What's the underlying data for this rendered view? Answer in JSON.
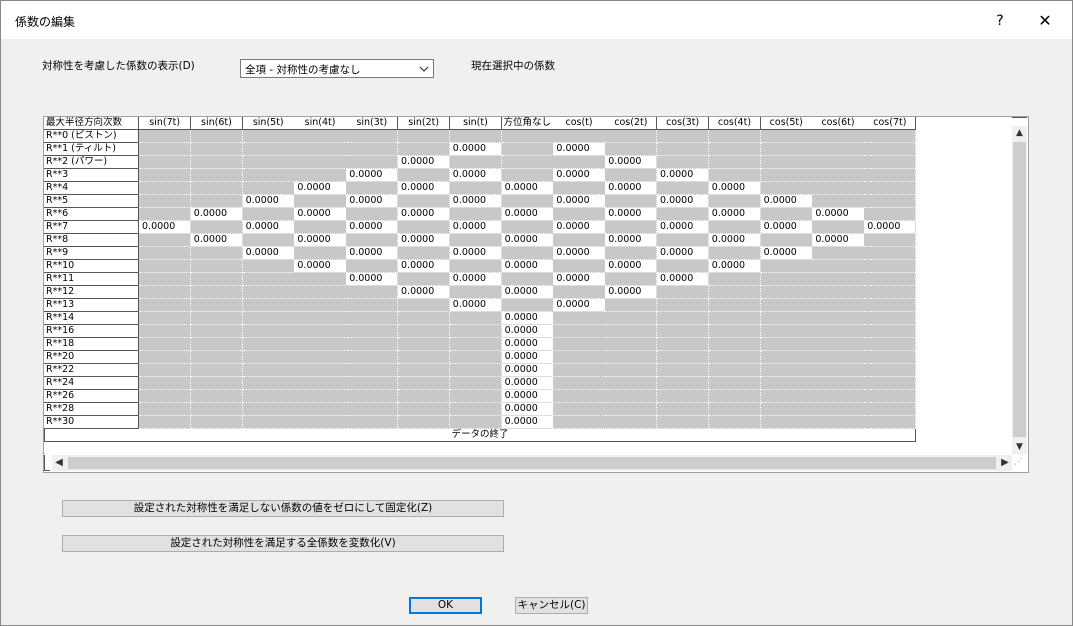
{
  "window": {
    "title": "係数の編集",
    "help": "?",
    "close": "✕"
  },
  "symmetry": {
    "label": "対称性を考慮した係数の表示(D)",
    "selected": "全項 - 対称性の考慮なし",
    "current_label": "現在選択中の係数"
  },
  "grid": {
    "corner": "最大半径方向次数",
    "columns": [
      "sin(7t)",
      "sin(6t)",
      "sin(5t)",
      "sin(4t)",
      "sin(3t)",
      "sin(2t)",
      "sin(t)",
      "方位角なし",
      "cos(t)",
      "cos(2t)",
      "cos(3t)",
      "cos(4t)",
      "cos(5t)",
      "cos(6t)",
      "cos(7t)"
    ],
    "rows": [
      "R**0 (ピストン)",
      "R**1 (ティルト)",
      "R**2 (パワー)",
      "R**3",
      "R**4",
      "R**5",
      "R**6",
      "R**7",
      "R**8",
      "R**9",
      "R**10",
      "R**11",
      "R**12",
      "R**13",
      "R**14",
      "R**16",
      "R**18",
      "R**20",
      "R**22",
      "R**24",
      "R**26",
      "R**28",
      "R**30"
    ],
    "cells": [
      [
        null,
        null,
        null,
        null,
        null,
        null,
        null,
        null,
        null,
        null,
        null,
        null,
        null,
        null,
        null
      ],
      [
        null,
        null,
        null,
        null,
        null,
        null,
        "0.0000",
        null,
        "0.0000",
        null,
        null,
        null,
        null,
        null,
        null
      ],
      [
        null,
        null,
        null,
        null,
        null,
        "0.0000",
        null,
        null,
        null,
        "0.0000",
        null,
        null,
        null,
        null,
        null
      ],
      [
        null,
        null,
        null,
        null,
        "0.0000",
        null,
        "0.0000",
        null,
        "0.0000",
        null,
        "0.0000",
        null,
        null,
        null,
        null
      ],
      [
        null,
        null,
        null,
        "0.0000",
        null,
        "0.0000",
        null,
        "0.0000",
        null,
        "0.0000",
        null,
        "0.0000",
        null,
        null,
        null
      ],
      [
        null,
        null,
        "0.0000",
        null,
        "0.0000",
        null,
        "0.0000",
        null,
        "0.0000",
        null,
        "0.0000",
        null,
        "0.0000",
        null,
        null
      ],
      [
        null,
        "0.0000",
        null,
        "0.0000",
        null,
        "0.0000",
        null,
        "0.0000",
        null,
        "0.0000",
        null,
        "0.0000",
        null,
        "0.0000",
        null
      ],
      [
        "0.0000",
        null,
        "0.0000",
        null,
        "0.0000",
        null,
        "0.0000",
        null,
        "0.0000",
        null,
        "0.0000",
        null,
        "0.0000",
        null,
        "0.0000"
      ],
      [
        null,
        "0.0000",
        null,
        "0.0000",
        null,
        "0.0000",
        null,
        "0.0000",
        null,
        "0.0000",
        null,
        "0.0000",
        null,
        "0.0000",
        null
      ],
      [
        null,
        null,
        "0.0000",
        null,
        "0.0000",
        null,
        "0.0000",
        null,
        "0.0000",
        null,
        "0.0000",
        null,
        "0.0000",
        null,
        null
      ],
      [
        null,
        null,
        null,
        "0.0000",
        null,
        "0.0000",
        null,
        "0.0000",
        null,
        "0.0000",
        null,
        "0.0000",
        null,
        null,
        null
      ],
      [
        null,
        null,
        null,
        null,
        "0.0000",
        null,
        "0.0000",
        null,
        "0.0000",
        null,
        "0.0000",
        null,
        null,
        null,
        null
      ],
      [
        null,
        null,
        null,
        null,
        null,
        "0.0000",
        null,
        "0.0000",
        null,
        "0.0000",
        null,
        null,
        null,
        null,
        null
      ],
      [
        null,
        null,
        null,
        null,
        null,
        null,
        "0.0000",
        null,
        "0.0000",
        null,
        null,
        null,
        null,
        null,
        null
      ],
      [
        null,
        null,
        null,
        null,
        null,
        null,
        null,
        "0.0000",
        null,
        null,
        null,
        null,
        null,
        null,
        null
      ],
      [
        null,
        null,
        null,
        null,
        null,
        null,
        null,
        "0.0000",
        null,
        null,
        null,
        null,
        null,
        null,
        null
      ],
      [
        null,
        null,
        null,
        null,
        null,
        null,
        null,
        "0.0000",
        null,
        null,
        null,
        null,
        null,
        null,
        null
      ],
      [
        null,
        null,
        null,
        null,
        null,
        null,
        null,
        "0.0000",
        null,
        null,
        null,
        null,
        null,
        null,
        null
      ],
      [
        null,
        null,
        null,
        null,
        null,
        null,
        null,
        "0.0000",
        null,
        null,
        null,
        null,
        null,
        null,
        null
      ],
      [
        null,
        null,
        null,
        null,
        null,
        null,
        null,
        "0.0000",
        null,
        null,
        null,
        null,
        null,
        null,
        null
      ],
      [
        null,
        null,
        null,
        null,
        null,
        null,
        null,
        "0.0000",
        null,
        null,
        null,
        null,
        null,
        null,
        null
      ],
      [
        null,
        null,
        null,
        null,
        null,
        null,
        null,
        "0.0000",
        null,
        null,
        null,
        null,
        null,
        null,
        null
      ],
      [
        null,
        null,
        null,
        null,
        null,
        null,
        null,
        "0.0000",
        null,
        null,
        null,
        null,
        null,
        null,
        null
      ]
    ],
    "end_label": "データの終了"
  },
  "actions": {
    "fix_zero": "設定された対称性を満足しない係数の値をゼロにして固定化(Z)",
    "make_variable": "設定された対称性を満足する全係数を変数化(V)"
  },
  "footer": {
    "ok": "OK",
    "cancel": "キャンセル(C)"
  },
  "icons": {
    "chevron": "chevron-down-icon",
    "close": "close-icon",
    "help": "help-icon"
  }
}
